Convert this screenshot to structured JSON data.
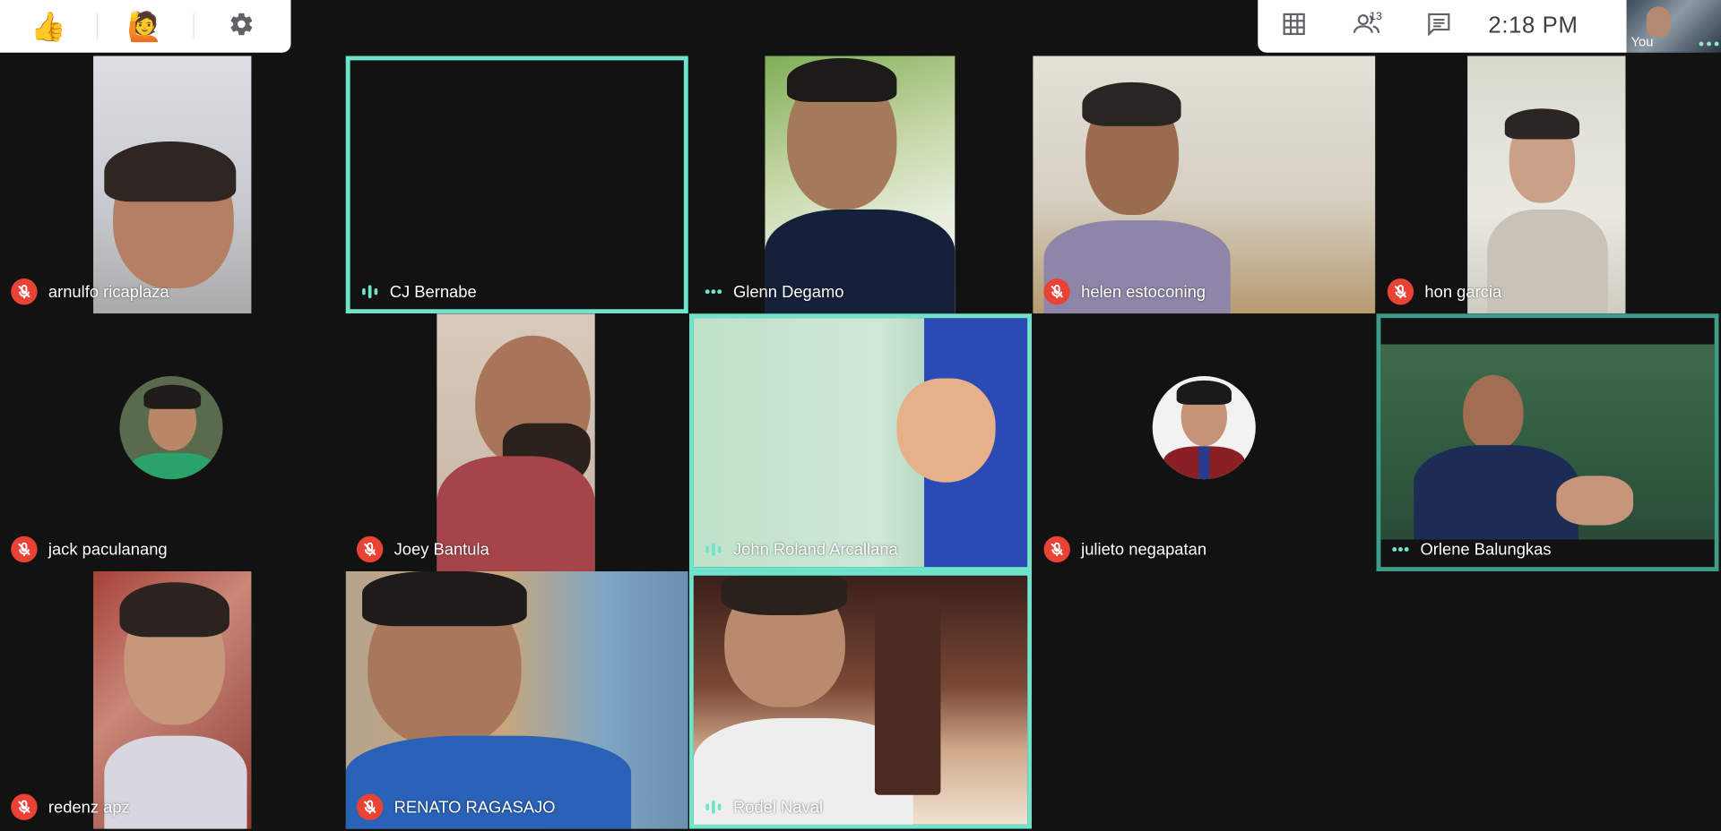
{
  "reactions": {
    "thumbs_up": "👍",
    "raise_hand": "🙋"
  },
  "top_bar": {
    "participant_count": "13",
    "clock": "2:18  PM",
    "self_label": "You"
  },
  "colors": {
    "speaking_border": "#6fe3cc",
    "muted_red": "#ea4335",
    "background": "#121212"
  },
  "participants": [
    {
      "name": "arnulfo ricaplaza",
      "status": "muted"
    },
    {
      "name": "CJ Bernabe",
      "status": "speaking"
    },
    {
      "name": "Glenn Degamo",
      "status": "active"
    },
    {
      "name": "helen estoconing",
      "status": "muted"
    },
    {
      "name": "hon garcia",
      "status": "muted"
    },
    {
      "name": "jack paculanang",
      "status": "muted"
    },
    {
      "name": "Joey Bantula",
      "status": "muted"
    },
    {
      "name": "John Roland Arcallana",
      "status": "speaking"
    },
    {
      "name": "julieto negapatan",
      "status": "muted"
    },
    {
      "name": "Orlene Balungkas",
      "status": "active"
    },
    {
      "name": "redenz apz",
      "status": "muted"
    },
    {
      "name": "RENATO RAGASAJO",
      "status": "muted"
    },
    {
      "name": "Rodel Naval",
      "status": "speaking"
    }
  ]
}
